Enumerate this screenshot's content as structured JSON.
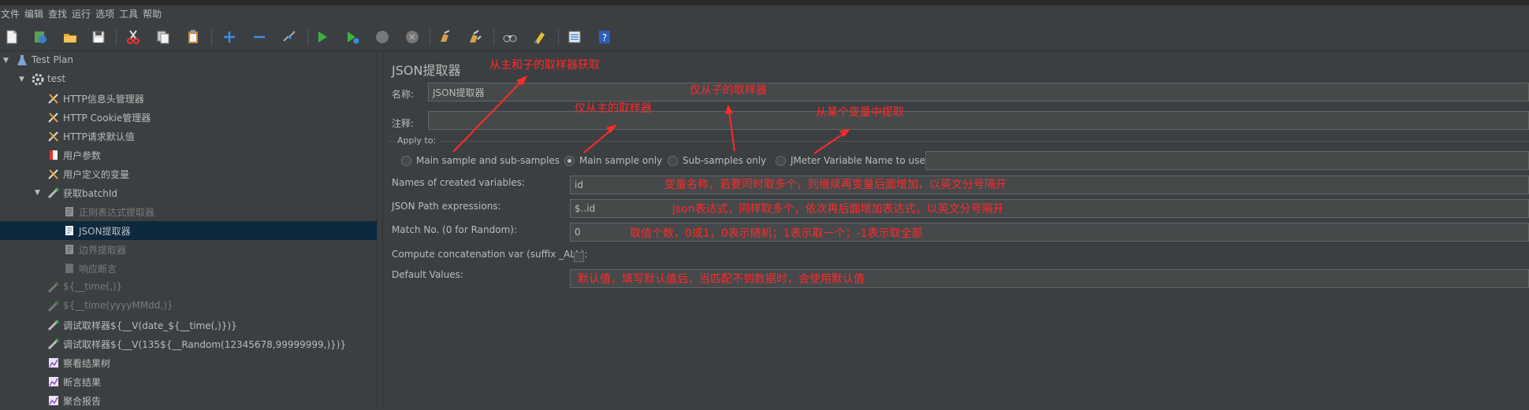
{
  "menu": [
    "文件",
    "编辑",
    "查找",
    "运行",
    "选项",
    "工具",
    "帮助"
  ],
  "toolbar_icons": [
    "new-icon",
    "templates-icon",
    "open-icon",
    "save-icon",
    "cut-icon",
    "copy-icon",
    "paste-icon",
    "expand-icon",
    "collapse-icon",
    "toggle-icon",
    "start-icon",
    "start-no-pause-icon",
    "stop-icon",
    "shutdown-icon",
    "clear-icon",
    "clear-all-icon",
    "search-icon",
    "reset-search-icon",
    "function-helper-icon",
    "help-icon"
  ],
  "tree": [
    {
      "label": "Test Plan",
      "icon": "test-plan-icon",
      "expanded": true
    },
    {
      "label": "test",
      "icon": "thread-group-icon",
      "expanded": true
    },
    {
      "label": "HTTP信息头管理器",
      "icon": "config-icon"
    },
    {
      "label": "HTTP Cookie管理器",
      "icon": "config-icon"
    },
    {
      "label": "HTTP请求默认值",
      "icon": "config-icon"
    },
    {
      "label": "用户参数",
      "icon": "preprocessor-icon"
    },
    {
      "label": "用户定义的变量",
      "icon": "config-icon"
    },
    {
      "label": "获取batchId",
      "icon": "sampler-icon",
      "expanded": true
    },
    {
      "label": "正则表达式提取器",
      "icon": "postprocessor-icon",
      "disabled": true
    },
    {
      "label": "JSON提取器",
      "icon": "postprocessor-icon",
      "selected": true
    },
    {
      "label": "边界提取器",
      "icon": "postprocessor-icon",
      "disabled": true
    },
    {
      "label": "响应断言",
      "icon": "assertion-icon",
      "disabled": true
    },
    {
      "label": "${__time(,)}",
      "icon": "sampler-icon",
      "disabled": true
    },
    {
      "label": "${__time(yyyyMMdd,)}",
      "icon": "sampler-icon",
      "disabled": true
    },
    {
      "label": "调试取样器${__V(date_${__time(,)})}",
      "icon": "sampler-icon"
    },
    {
      "label": "调试取样器${__V(135${__Random(12345678,99999999,)})}",
      "icon": "sampler-icon"
    },
    {
      "label": "察看结果树",
      "icon": "listener-icon"
    },
    {
      "label": "断言结果",
      "icon": "listener-icon"
    },
    {
      "label": "聚合报告",
      "icon": "listener-icon"
    }
  ],
  "panel": {
    "title": "JSON提取器",
    "name_label": "名称:",
    "name_value": "JSON提取器",
    "comment_label": "注释:",
    "comment_value": "",
    "apply_to": "Apply to:",
    "radio_options": [
      "Main sample and sub-samples",
      "Main sample only",
      "Sub-samples only",
      "JMeter Variable Name to use"
    ],
    "radio_selected": "Main sample only",
    "var_name_to_use": "",
    "names_label": "Names of created variables:",
    "names_value": "id",
    "path_label": "JSON Path expressions:",
    "path_value": "$..id",
    "match_label": "Match No. (0 for Random):",
    "match_value": "0",
    "concat_label": "Compute concatenation var (suffix _ALL):",
    "concat_checked": false,
    "default_label": "Default Values:",
    "default_value": ""
  },
  "annotations": {
    "main_and_sub": "从主和子的取样器获取",
    "main_only": "仅从主的取样器",
    "sub_only": "仅从子的取样器",
    "variable": "从某个变量中提取",
    "names": "变量名称，若要同时取多个，则继续再变量后面增加，以英文分号隔开",
    "path": "json表达式，同样取多个，依次再后面增加表达式，以英文分号隔开",
    "match": "取值个数，0或1，0表示随机；1表示取一个；-1表示取全部",
    "default": "默认值，填写默认值后，当匹配不到数据时，会使用默认值",
    "color": "#ff2a2a"
  }
}
